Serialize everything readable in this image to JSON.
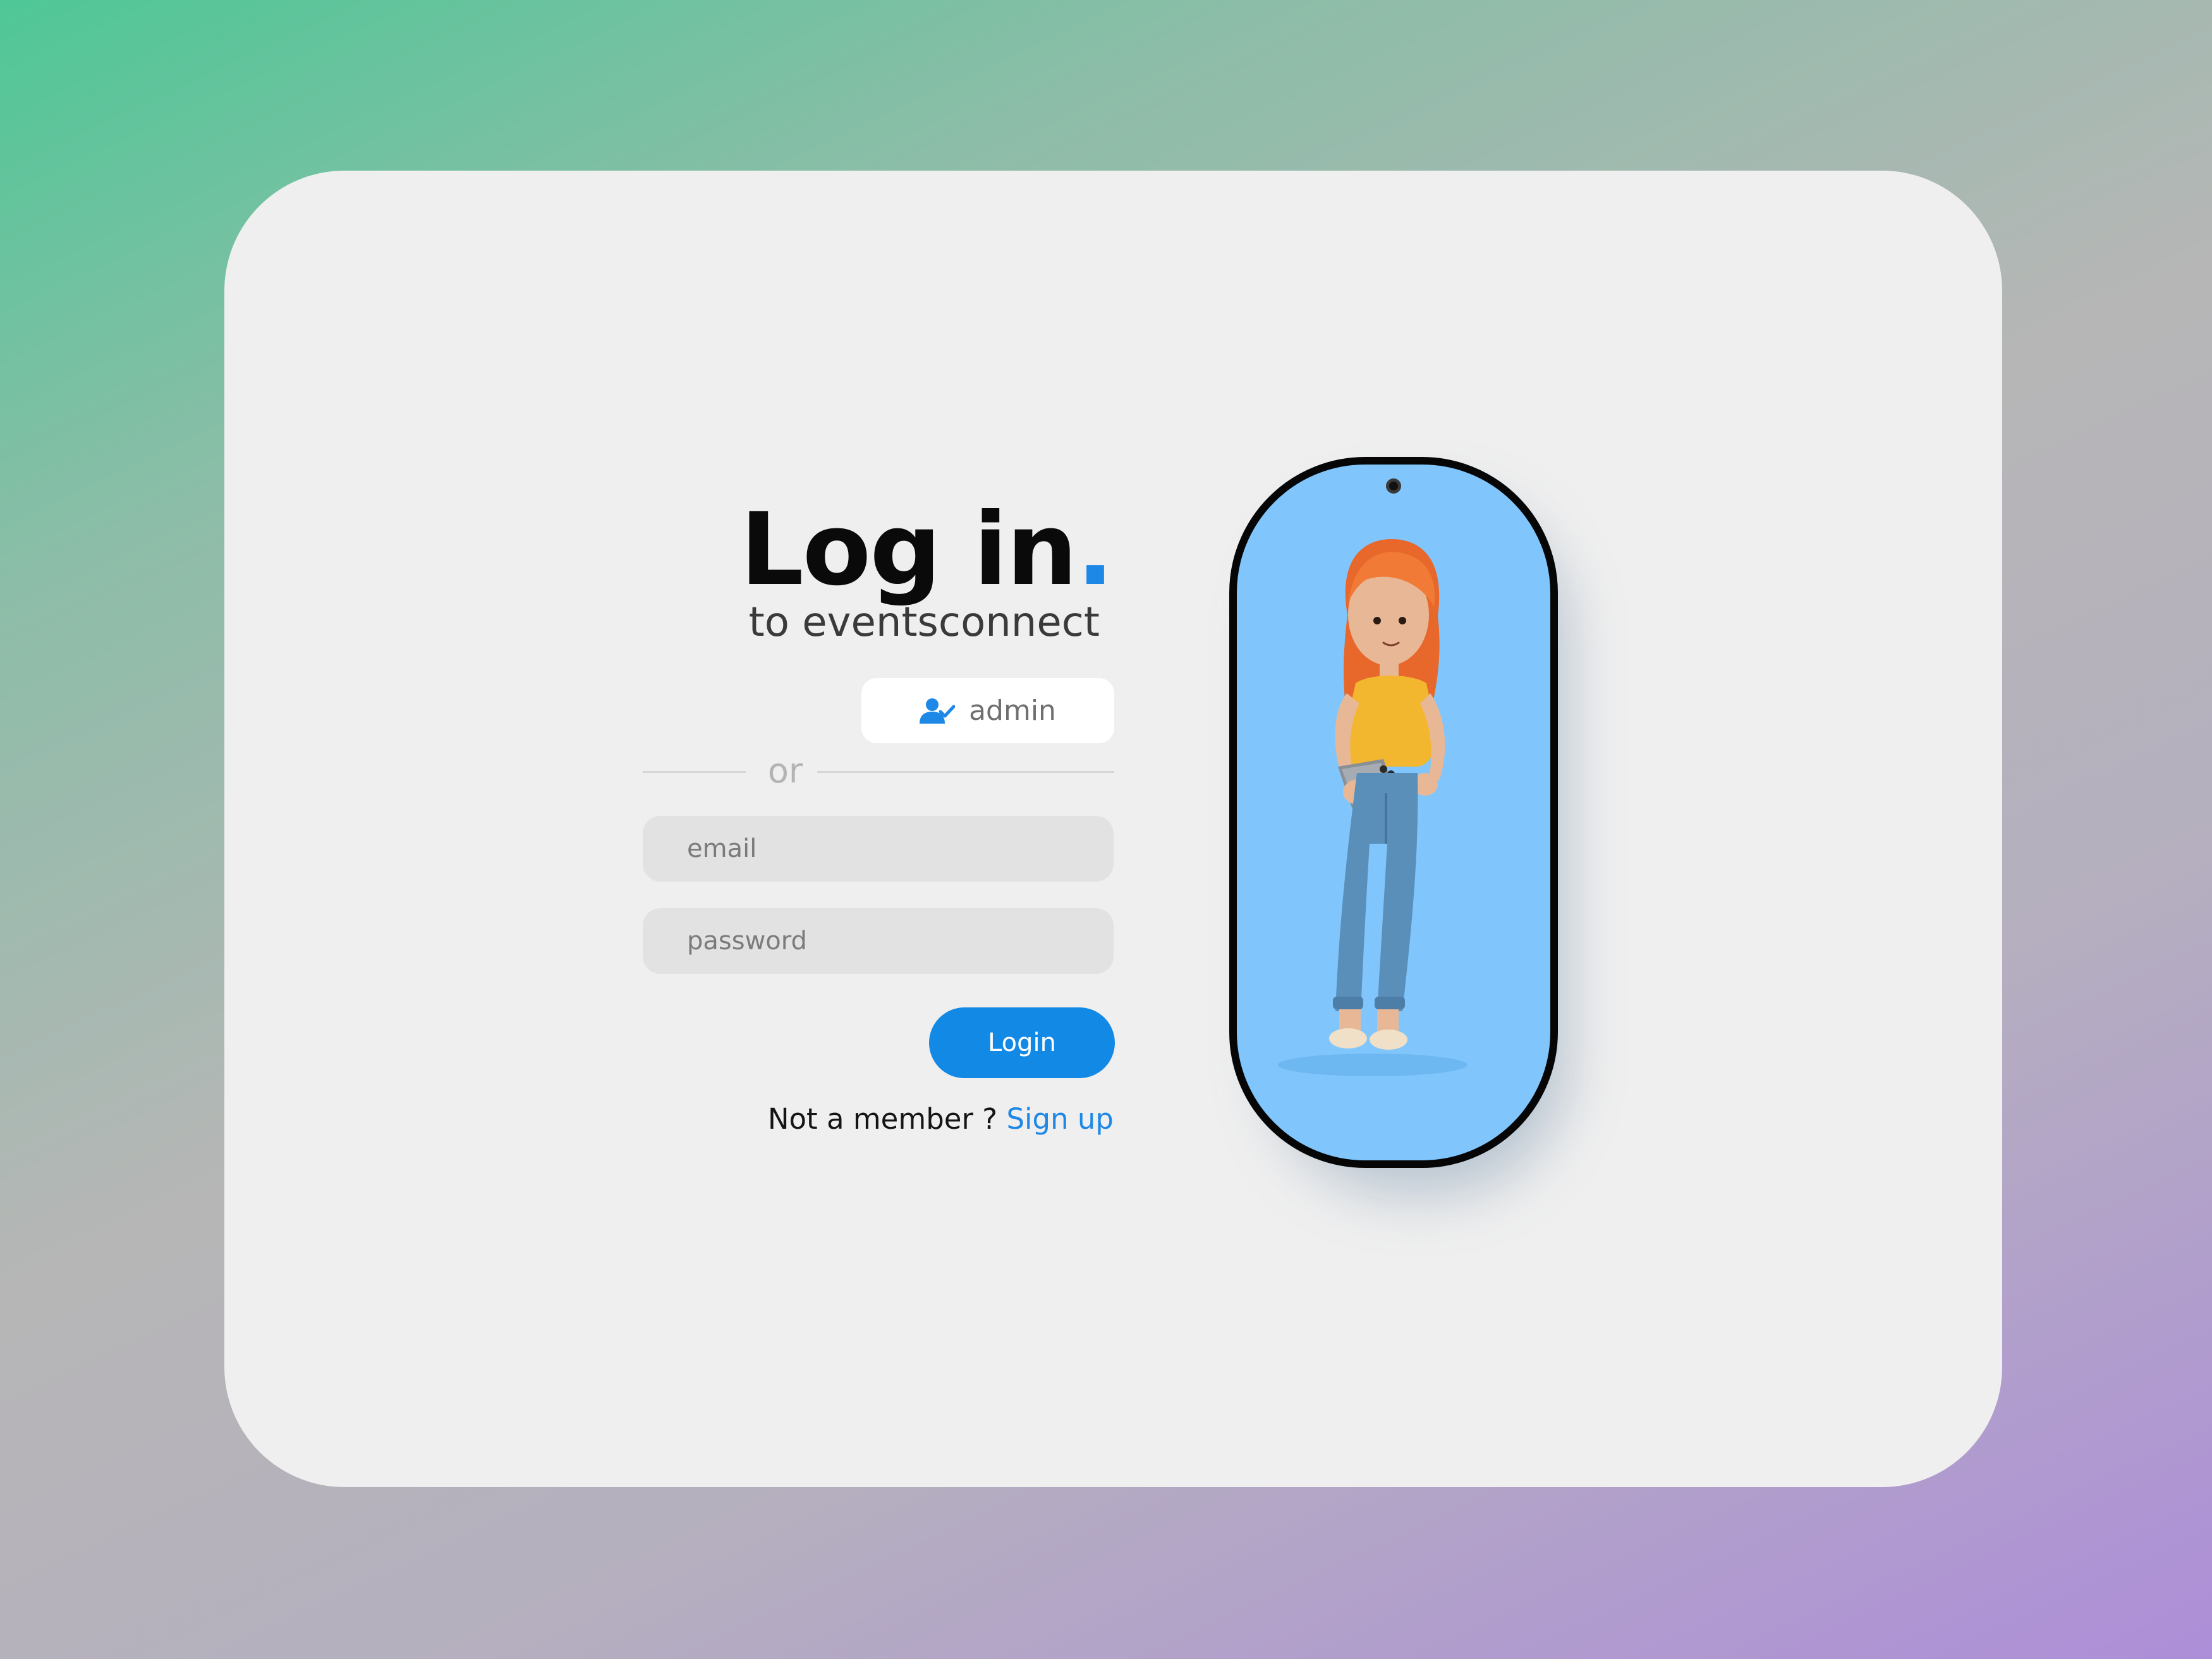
{
  "login": {
    "title": "Log in",
    "title_dot": ".",
    "subtitle": "to eventsconnect",
    "admin_label": "admin",
    "divider_text": "or",
    "email_placeholder": "email",
    "password_placeholder": "password",
    "login_button": "Login",
    "not_member_text": "Not a member ? ",
    "signup_link": "Sign up"
  },
  "icons": {
    "admin": "user-check-icon",
    "camera": "camera-icon"
  },
  "colors": {
    "accent": "#1389e6",
    "card_background": "#efefef",
    "phone_screen": "#80c6fc",
    "input_background": "#e2e2e2"
  }
}
